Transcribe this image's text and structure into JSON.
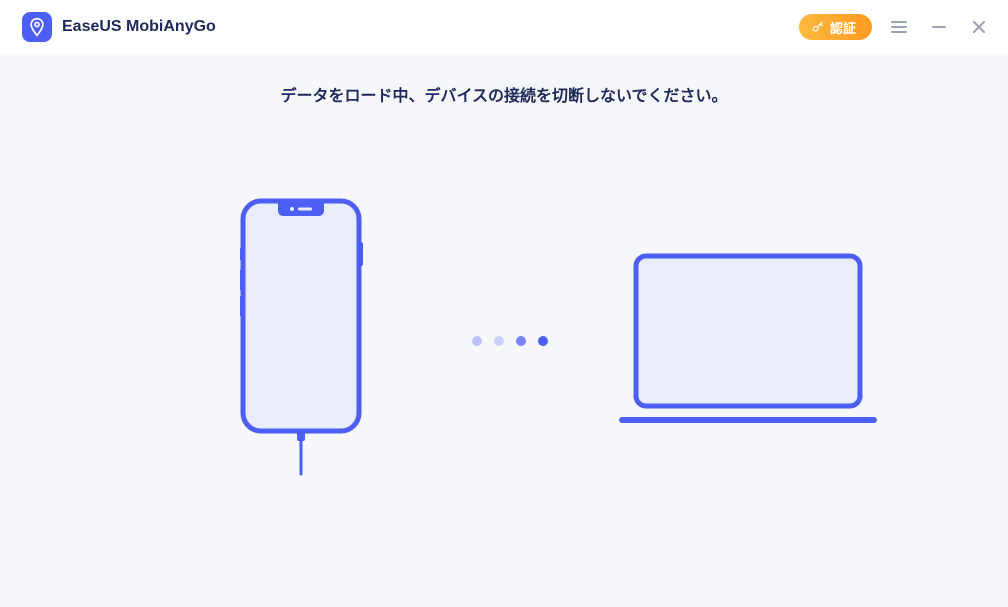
{
  "app": {
    "title": "EaseUS MobiAnyGo"
  },
  "header": {
    "verify_label": "認証"
  },
  "status": {
    "message": "データをロード中、デバイスの接続を切断しないでください。"
  },
  "colors": {
    "primary": "#4d5ef5",
    "accent_start": "#ffb940",
    "accent_end": "#ff9a1e"
  }
}
